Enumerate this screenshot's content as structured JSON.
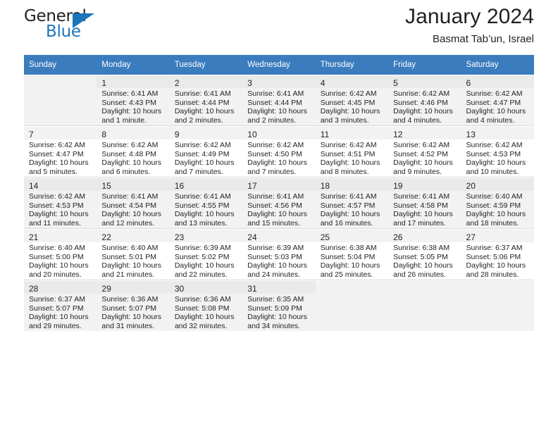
{
  "brand": {
    "name_top": "General",
    "name_bottom": "Blue",
    "triangle_color": "#1b75bb"
  },
  "header": {
    "title": "January 2024",
    "subtitle": "Basmat Tab’un, Israel"
  },
  "theme": {
    "header_bg": "#3a7cbe",
    "header_text": "#ffffff",
    "shaded_row_bg": "#f2f2f2",
    "text": "#231f20"
  },
  "weekdays": [
    "Sunday",
    "Monday",
    "Tuesday",
    "Wednesday",
    "Thursday",
    "Friday",
    "Saturday"
  ],
  "labels": {
    "sunrise": "Sunrise:",
    "sunset": "Sunset:",
    "daylight": "Daylight:"
  },
  "weeks": [
    {
      "shaded": true,
      "days": [
        {
          "num": "",
          "empty": true
        },
        {
          "num": "1",
          "sunrise": "Sunrise: 6:41 AM",
          "sunset": "Sunset: 4:43 PM",
          "daylight1": "Daylight: 10 hours",
          "daylight2": "and 1 minute."
        },
        {
          "num": "2",
          "sunrise": "Sunrise: 6:41 AM",
          "sunset": "Sunset: 4:44 PM",
          "daylight1": "Daylight: 10 hours",
          "daylight2": "and 2 minutes."
        },
        {
          "num": "3",
          "sunrise": "Sunrise: 6:41 AM",
          "sunset": "Sunset: 4:44 PM",
          "daylight1": "Daylight: 10 hours",
          "daylight2": "and 2 minutes."
        },
        {
          "num": "4",
          "sunrise": "Sunrise: 6:42 AM",
          "sunset": "Sunset: 4:45 PM",
          "daylight1": "Daylight: 10 hours",
          "daylight2": "and 3 minutes."
        },
        {
          "num": "5",
          "sunrise": "Sunrise: 6:42 AM",
          "sunset": "Sunset: 4:46 PM",
          "daylight1": "Daylight: 10 hours",
          "daylight2": "and 4 minutes."
        },
        {
          "num": "6",
          "sunrise": "Sunrise: 6:42 AM",
          "sunset": "Sunset: 4:47 PM",
          "daylight1": "Daylight: 10 hours",
          "daylight2": "and 4 minutes."
        }
      ]
    },
    {
      "shaded": false,
      "days": [
        {
          "num": "7",
          "sunrise": "Sunrise: 6:42 AM",
          "sunset": "Sunset: 4:47 PM",
          "daylight1": "Daylight: 10 hours",
          "daylight2": "and 5 minutes."
        },
        {
          "num": "8",
          "sunrise": "Sunrise: 6:42 AM",
          "sunset": "Sunset: 4:48 PM",
          "daylight1": "Daylight: 10 hours",
          "daylight2": "and 6 minutes."
        },
        {
          "num": "9",
          "sunrise": "Sunrise: 6:42 AM",
          "sunset": "Sunset: 4:49 PM",
          "daylight1": "Daylight: 10 hours",
          "daylight2": "and 7 minutes."
        },
        {
          "num": "10",
          "sunrise": "Sunrise: 6:42 AM",
          "sunset": "Sunset: 4:50 PM",
          "daylight1": "Daylight: 10 hours",
          "daylight2": "and 7 minutes."
        },
        {
          "num": "11",
          "sunrise": "Sunrise: 6:42 AM",
          "sunset": "Sunset: 4:51 PM",
          "daylight1": "Daylight: 10 hours",
          "daylight2": "and 8 minutes."
        },
        {
          "num": "12",
          "sunrise": "Sunrise: 6:42 AM",
          "sunset": "Sunset: 4:52 PM",
          "daylight1": "Daylight: 10 hours",
          "daylight2": "and 9 minutes."
        },
        {
          "num": "13",
          "sunrise": "Sunrise: 6:42 AM",
          "sunset": "Sunset: 4:53 PM",
          "daylight1": "Daylight: 10 hours",
          "daylight2": "and 10 minutes."
        }
      ]
    },
    {
      "shaded": true,
      "days": [
        {
          "num": "14",
          "sunrise": "Sunrise: 6:42 AM",
          "sunset": "Sunset: 4:53 PM",
          "daylight1": "Daylight: 10 hours",
          "daylight2": "and 11 minutes."
        },
        {
          "num": "15",
          "sunrise": "Sunrise: 6:41 AM",
          "sunset": "Sunset: 4:54 PM",
          "daylight1": "Daylight: 10 hours",
          "daylight2": "and 12 minutes."
        },
        {
          "num": "16",
          "sunrise": "Sunrise: 6:41 AM",
          "sunset": "Sunset: 4:55 PM",
          "daylight1": "Daylight: 10 hours",
          "daylight2": "and 13 minutes."
        },
        {
          "num": "17",
          "sunrise": "Sunrise: 6:41 AM",
          "sunset": "Sunset: 4:56 PM",
          "daylight1": "Daylight: 10 hours",
          "daylight2": "and 15 minutes."
        },
        {
          "num": "18",
          "sunrise": "Sunrise: 6:41 AM",
          "sunset": "Sunset: 4:57 PM",
          "daylight1": "Daylight: 10 hours",
          "daylight2": "and 16 minutes."
        },
        {
          "num": "19",
          "sunrise": "Sunrise: 6:41 AM",
          "sunset": "Sunset: 4:58 PM",
          "daylight1": "Daylight: 10 hours",
          "daylight2": "and 17 minutes."
        },
        {
          "num": "20",
          "sunrise": "Sunrise: 6:40 AM",
          "sunset": "Sunset: 4:59 PM",
          "daylight1": "Daylight: 10 hours",
          "daylight2": "and 18 minutes."
        }
      ]
    },
    {
      "shaded": false,
      "days": [
        {
          "num": "21",
          "sunrise": "Sunrise: 6:40 AM",
          "sunset": "Sunset: 5:00 PM",
          "daylight1": "Daylight: 10 hours",
          "daylight2": "and 20 minutes."
        },
        {
          "num": "22",
          "sunrise": "Sunrise: 6:40 AM",
          "sunset": "Sunset: 5:01 PM",
          "daylight1": "Daylight: 10 hours",
          "daylight2": "and 21 minutes."
        },
        {
          "num": "23",
          "sunrise": "Sunrise: 6:39 AM",
          "sunset": "Sunset: 5:02 PM",
          "daylight1": "Daylight: 10 hours",
          "daylight2": "and 22 minutes."
        },
        {
          "num": "24",
          "sunrise": "Sunrise: 6:39 AM",
          "sunset": "Sunset: 5:03 PM",
          "daylight1": "Daylight: 10 hours",
          "daylight2": "and 24 minutes."
        },
        {
          "num": "25",
          "sunrise": "Sunrise: 6:38 AM",
          "sunset": "Sunset: 5:04 PM",
          "daylight1": "Daylight: 10 hours",
          "daylight2": "and 25 minutes."
        },
        {
          "num": "26",
          "sunrise": "Sunrise: 6:38 AM",
          "sunset": "Sunset: 5:05 PM",
          "daylight1": "Daylight: 10 hours",
          "daylight2": "and 26 minutes."
        },
        {
          "num": "27",
          "sunrise": "Sunrise: 6:37 AM",
          "sunset": "Sunset: 5:06 PM",
          "daylight1": "Daylight: 10 hours",
          "daylight2": "and 28 minutes."
        }
      ]
    },
    {
      "shaded": true,
      "days": [
        {
          "num": "28",
          "sunrise": "Sunrise: 6:37 AM",
          "sunset": "Sunset: 5:07 PM",
          "daylight1": "Daylight: 10 hours",
          "daylight2": "and 29 minutes."
        },
        {
          "num": "29",
          "sunrise": "Sunrise: 6:36 AM",
          "sunset": "Sunset: 5:07 PM",
          "daylight1": "Daylight: 10 hours",
          "daylight2": "and 31 minutes."
        },
        {
          "num": "30",
          "sunrise": "Sunrise: 6:36 AM",
          "sunset": "Sunset: 5:08 PM",
          "daylight1": "Daylight: 10 hours",
          "daylight2": "and 32 minutes."
        },
        {
          "num": "31",
          "sunrise": "Sunrise: 6:35 AM",
          "sunset": "Sunset: 5:09 PM",
          "daylight1": "Daylight: 10 hours",
          "daylight2": "and 34 minutes."
        },
        {
          "num": "",
          "empty": true
        },
        {
          "num": "",
          "empty": true
        },
        {
          "num": "",
          "empty": true
        }
      ]
    }
  ]
}
